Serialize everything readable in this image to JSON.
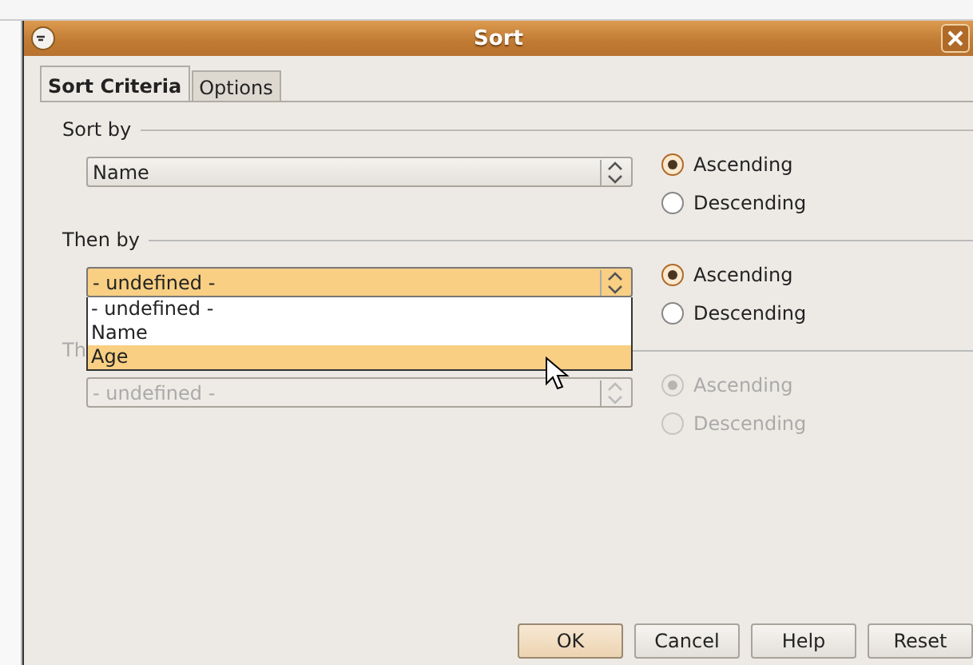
{
  "window": {
    "title": "Sort"
  },
  "tabs": [
    {
      "label": "Sort Criteria",
      "selected": true
    },
    {
      "label": "Options",
      "selected": false
    }
  ],
  "groups": [
    {
      "label": "Sort by",
      "disabled": false,
      "field": {
        "value": "Name",
        "active": false
      },
      "orders": [
        {
          "label": "Ascending",
          "selected": true
        },
        {
          "label": "Descending",
          "selected": false
        }
      ]
    },
    {
      "label": "Then by",
      "disabled": false,
      "field": {
        "value": "- undefined -",
        "active": true
      },
      "dropdown": [
        {
          "label": "- undefined -",
          "selected": false
        },
        {
          "label": "Name",
          "selected": false
        },
        {
          "label": "Age",
          "selected": true
        }
      ],
      "orders": [
        {
          "label": "Ascending",
          "selected": true
        },
        {
          "label": "Descending",
          "selected": false
        }
      ]
    },
    {
      "label": "Th",
      "disabled": true,
      "field": {
        "value": "- undefined -",
        "active": false
      },
      "orders": [
        {
          "label": "Ascending",
          "selected": true
        },
        {
          "label": "Descending",
          "selected": false
        }
      ]
    }
  ],
  "buttons": [
    {
      "label": "OK",
      "default": true
    },
    {
      "label": "Cancel",
      "default": false
    },
    {
      "label": "Help",
      "default": false
    },
    {
      "label": "Reset",
      "default": false
    }
  ]
}
